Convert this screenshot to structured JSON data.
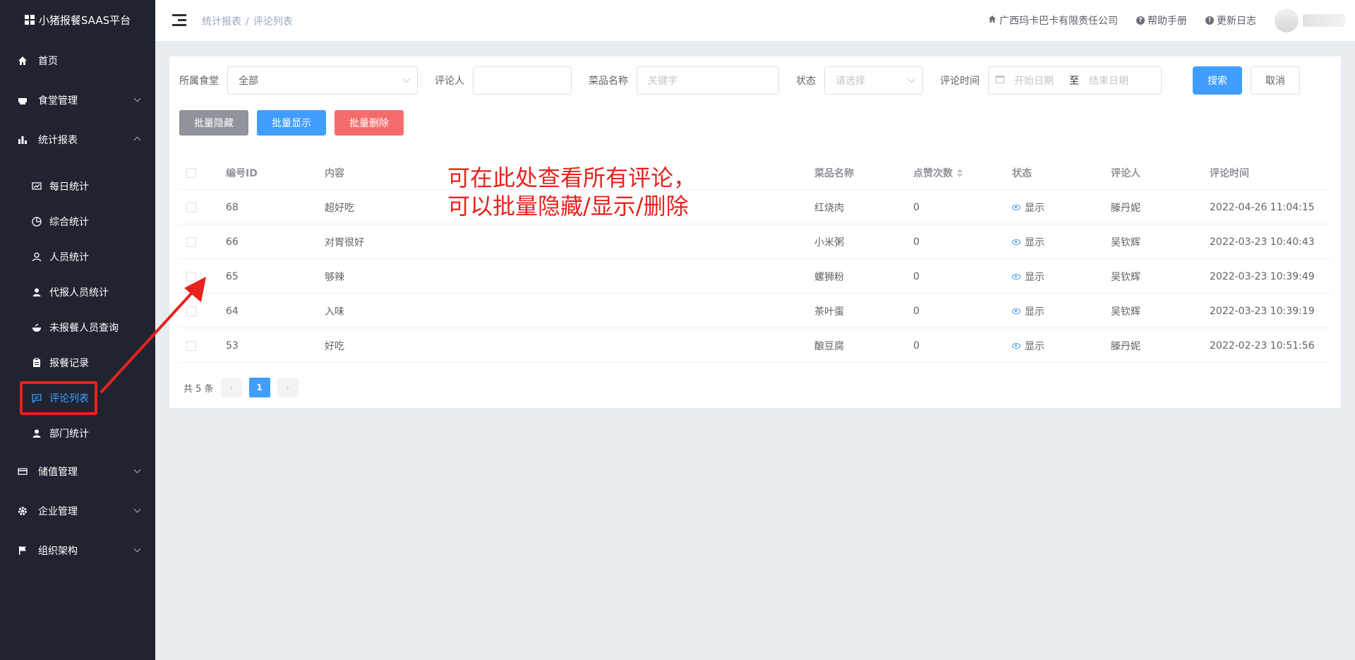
{
  "app": {
    "title": "小猪报餐SAAS平台"
  },
  "sidebar": {
    "items": [
      {
        "label": "首页"
      },
      {
        "label": "食堂管理"
      },
      {
        "label": "统计报表"
      },
      {
        "label": "储值管理"
      },
      {
        "label": "企业管理"
      },
      {
        "label": "组织架构"
      }
    ],
    "sub_items": [
      {
        "label": "每日统计"
      },
      {
        "label": "综合统计"
      },
      {
        "label": "人员统计"
      },
      {
        "label": "代报人员统计"
      },
      {
        "label": "未报餐人员查询"
      },
      {
        "label": "报餐记录"
      },
      {
        "label": "评论列表"
      },
      {
        "label": "部门统计"
      }
    ]
  },
  "header": {
    "breadcrumb": [
      "统计报表",
      "评论列表"
    ],
    "breadcrumb_sep": "/",
    "company": "广西玛卡巴卡有限责任公司",
    "help": "帮助手册",
    "changelog": "更新日志"
  },
  "filters": {
    "canteen_label": "所属食堂",
    "canteen_value": "全部",
    "reviewer_label": "评论人",
    "reviewer_value": "",
    "dish_label": "菜品名称",
    "dish_placeholder": "关键字",
    "status_label": "状态",
    "status_placeholder": "请选择",
    "time_label": "评论时间",
    "start_placeholder": "开始日期",
    "range_sep": "至",
    "end_placeholder": "结束日期",
    "search_btn": "搜索",
    "cancel_btn": "取消"
  },
  "batch": {
    "hide": "批量隐藏",
    "show": "批量显示",
    "delete": "批量删除"
  },
  "table": {
    "headers": [
      "编号ID",
      "内容",
      "菜品名称",
      "点赞次数",
      "状态",
      "评论人",
      "评论时间"
    ],
    "rows": [
      {
        "id": "68",
        "content": "超好吃",
        "dish": "红烧肉",
        "likes": "0",
        "status": "显示",
        "reviewer": "滕丹妮",
        "time": "2022-04-26 11:04:15"
      },
      {
        "id": "66",
        "content": "对胃很好",
        "dish": "小米粥",
        "likes": "0",
        "status": "显示",
        "reviewer": "吴钦辉",
        "time": "2022-03-23 10:40:43"
      },
      {
        "id": "65",
        "content": "够辣",
        "dish": "螺狮粉",
        "likes": "0",
        "status": "显示",
        "reviewer": "吴钦辉",
        "time": "2022-03-23 10:39:49"
      },
      {
        "id": "64",
        "content": "入味",
        "dish": "茶叶蛋",
        "likes": "0",
        "status": "显示",
        "reviewer": "吴钦辉",
        "time": "2022-03-23 10:39:19"
      },
      {
        "id": "53",
        "content": "好吃",
        "dish": "酿豆腐",
        "likes": "0",
        "status": "显示",
        "reviewer": "滕丹妮",
        "time": "2022-02-23 10:51:56"
      }
    ]
  },
  "pager": {
    "total": "共 5 条",
    "prev": "‹",
    "page": "1",
    "next": "›"
  },
  "annotation": "可在此处查看所有评论，\n可以批量隐藏/显示/删除",
  "colors": {
    "primary": "#409eff",
    "sidebar_bg": "#1f2430",
    "danger": "#f56c6c",
    "annotation": "#e8221c"
  }
}
